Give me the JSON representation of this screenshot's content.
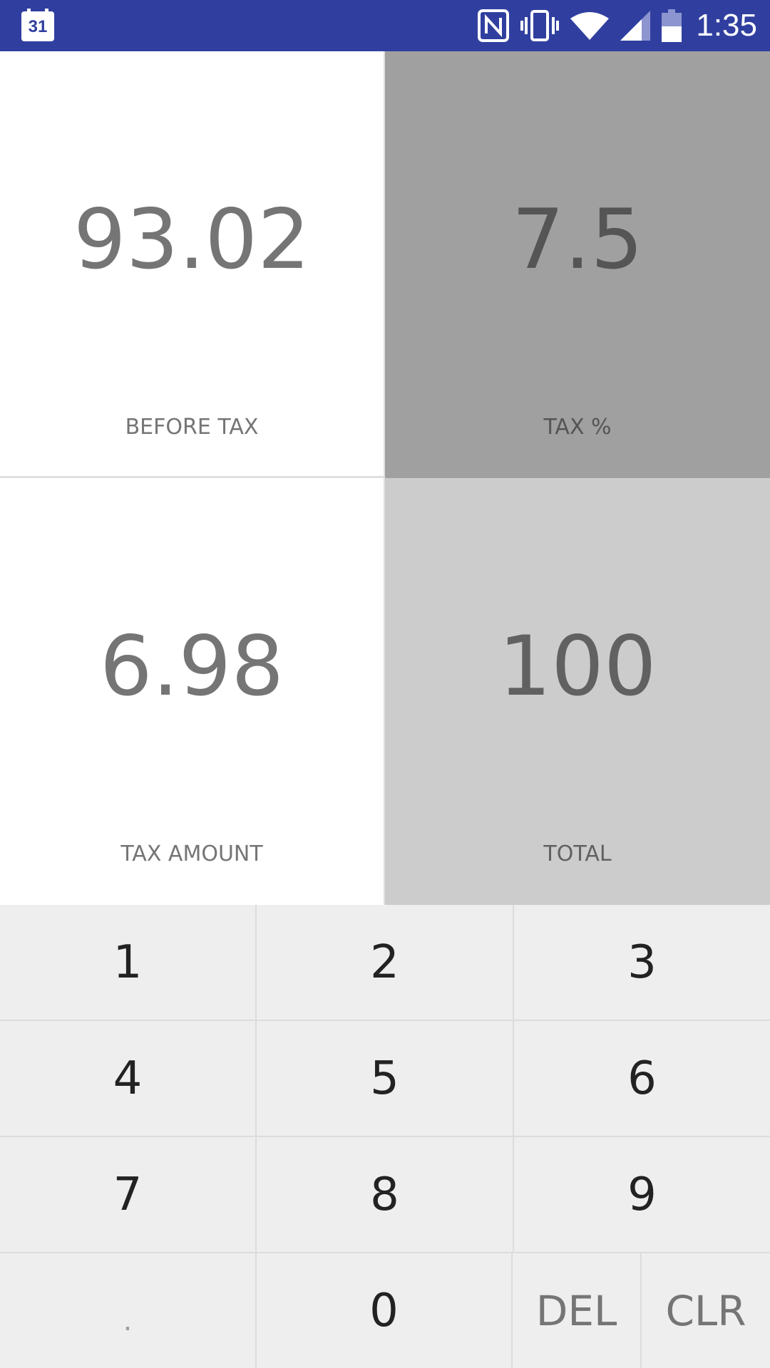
{
  "status_bar": {
    "calendar_day": "31",
    "time": "1:35",
    "icons": [
      "nfc-icon",
      "vibrate-icon",
      "wifi-icon",
      "signal-icon",
      "battery-icon"
    ]
  },
  "display": {
    "before_tax": {
      "value": "93.02",
      "label": "BEFORE TAX"
    },
    "tax_percent": {
      "value": "7.5",
      "label": "TAX %"
    },
    "tax_amount": {
      "value": "6.98",
      "label": "TAX AMOUNT"
    },
    "total": {
      "value": "100",
      "label": "TOTAL"
    }
  },
  "keypad": {
    "k1": "1",
    "k2": "2",
    "k3": "3",
    "k4": "4",
    "k5": "5",
    "k6": "6",
    "k7": "7",
    "k8": "8",
    "k9": "9",
    "kdot": ".",
    "k0": "0",
    "del": "DEL",
    "clr": "CLR"
  },
  "colors": {
    "status_bar": "#303f9f",
    "tax_percent_bg": "#a0a0a0",
    "total_bg": "#cccccc",
    "keypad_bg": "#eeeeee"
  }
}
